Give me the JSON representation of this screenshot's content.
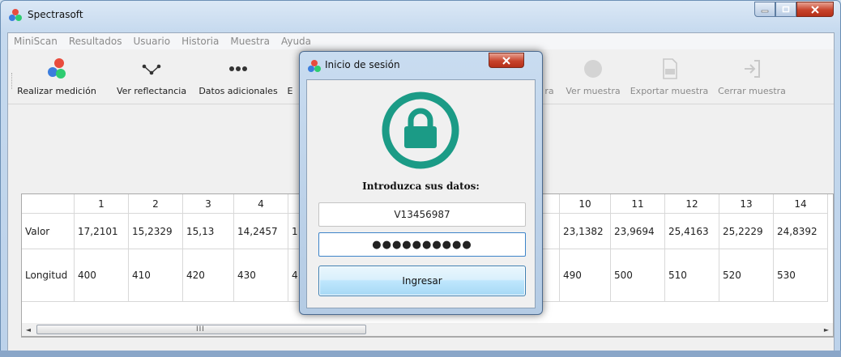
{
  "window": {
    "title": "Spectrasoft"
  },
  "menu": [
    "MiniScan",
    "Resultados",
    "Usuario",
    "Historia",
    "Muestra",
    "Ayuda"
  ],
  "toolbar": {
    "items": [
      {
        "label": "Realizar medición",
        "icon": "color-dots-icon",
        "enabled": true
      },
      {
        "label": "Ver reflectancia",
        "icon": "line-chart-icon",
        "enabled": true
      },
      {
        "label": "Datos adicionales",
        "icon": "more-dots-icon",
        "enabled": true
      },
      {
        "label": "E",
        "icon": "",
        "enabled": true
      },
      {
        "label": "ra",
        "icon": "",
        "enabled": false
      },
      {
        "label": "Ver muestra",
        "icon": "circle-icon",
        "enabled": false
      },
      {
        "label": "Exportar muestra",
        "icon": "export-file-icon",
        "enabled": false
      },
      {
        "label": "Cerrar muestra",
        "icon": "logout-icon",
        "enabled": false
      }
    ]
  },
  "table": {
    "columns": [
      "1",
      "2",
      "3",
      "4",
      "",
      "",
      "",
      "",
      "",
      "10",
      "11",
      "12",
      "13",
      "14"
    ],
    "rows": [
      {
        "label": "Valor",
        "cells": [
          "17,2101",
          "15,2329",
          "15,13",
          "14,2457",
          "1",
          "",
          "",
          "",
          "",
          "23,1382",
          "23,9694",
          "25,4163",
          "25,2229",
          "24,8392"
        ]
      },
      {
        "label": "Longitud",
        "cells": [
          "400",
          "410",
          "420",
          "430",
          "4",
          "",
          "",
          "",
          "",
          "490",
          "500",
          "510",
          "520",
          "530"
        ]
      }
    ]
  },
  "scroll": {
    "left": "◄",
    "right": "►",
    "grip": "III"
  },
  "dialog": {
    "title": "Inicio de sesión",
    "prompt": "Introduzca sus datos:",
    "username_value": "V13456987",
    "password_value": "●●●●●●●●●●",
    "submit_label": "Ingresar"
  },
  "colors": {
    "accent": "#1b9b86",
    "dot_red": "#e94c3d",
    "dot_green": "#2ecc71",
    "dot_blue": "#3b7ddd"
  }
}
